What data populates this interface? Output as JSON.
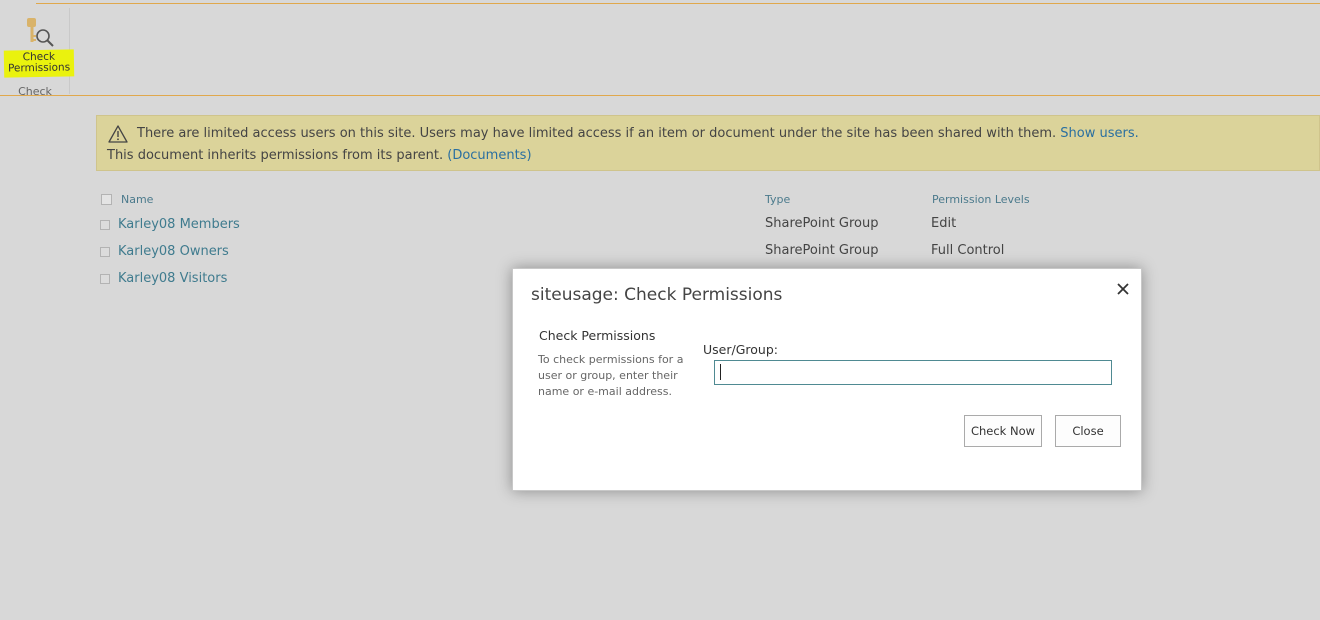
{
  "ribbon": {
    "check_permissions_label_line1": "Check",
    "check_permissions_label_line2": "Permissions",
    "group_label": "Check",
    "icon": "key-magnifier-icon",
    "highlight_color": "#eaf20e"
  },
  "banner": {
    "line1_text": "There are limited access users on this site. Users may have limited access if an item or document under the site has been shared with them.",
    "show_users_link": "Show users.",
    "line2_text": "This document inherits permissions from its parent.",
    "documents_link": "(Documents)",
    "icon": "warning-icon",
    "background": "#dbd39a"
  },
  "list": {
    "columns": {
      "name": "Name",
      "type": "Type",
      "permission_levels": "Permission Levels"
    },
    "rows": [
      {
        "name": "Karley08 Members",
        "type": "SharePoint Group",
        "permission": "Edit"
      },
      {
        "name": "Karley08 Owners",
        "type": "SharePoint Group",
        "permission": "Full Control"
      },
      {
        "name": "Karley08 Visitors",
        "type": "",
        "permission": ""
      }
    ]
  },
  "dialog": {
    "title": "siteusage: Check Permissions",
    "close_icon": "close-icon",
    "section_title": "Check Permissions",
    "section_description": "To check permissions for a user or group, enter their name or e-mail address.",
    "field_label": "User/Group:",
    "user_group_value": "",
    "check_now_label": "Check Now",
    "close_label": "Close"
  }
}
